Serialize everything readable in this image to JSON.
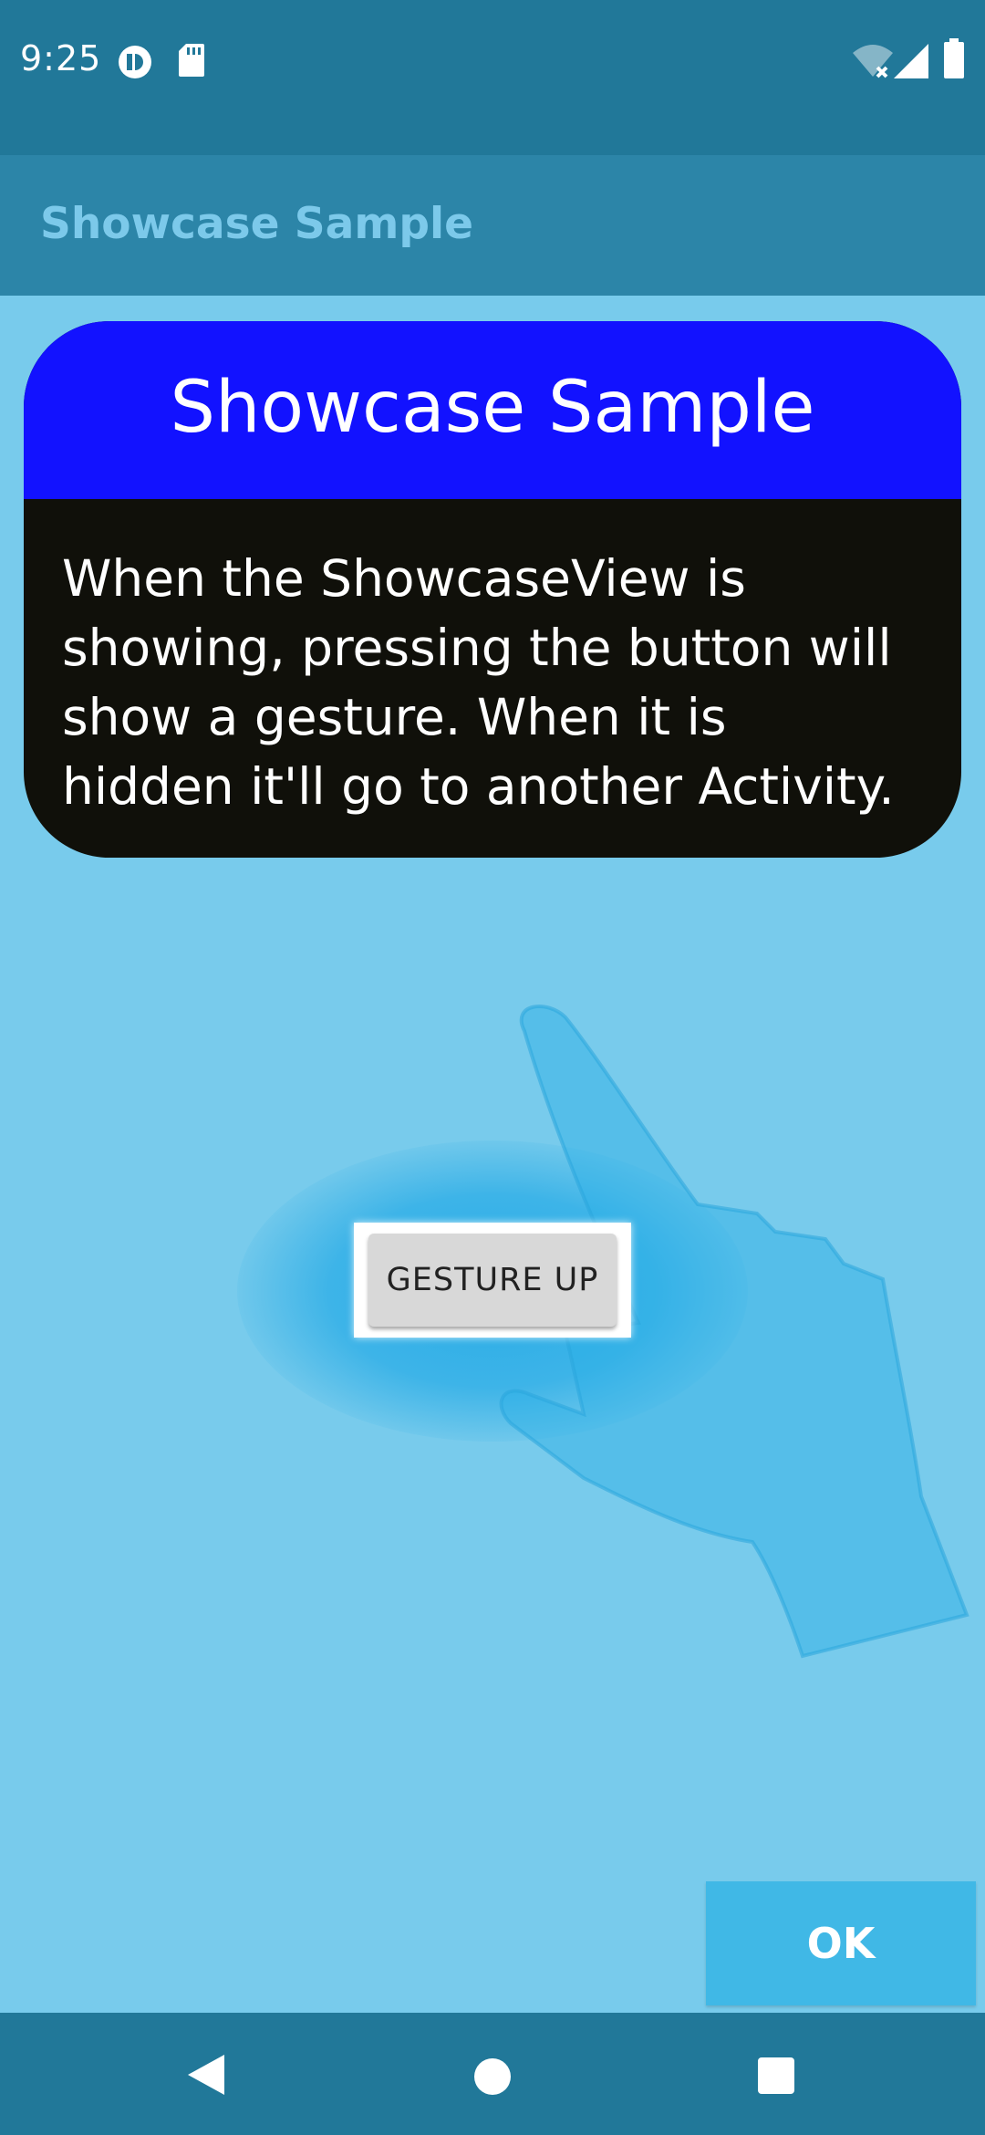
{
  "status_bar": {
    "time": "9:25",
    "icons": [
      "sync-icon",
      "sd-card-icon",
      "wifi-off-icon",
      "cell-signal-icon",
      "battery-icon"
    ]
  },
  "app_bar": {
    "title": "Showcase Sample"
  },
  "showcase": {
    "title": "Showcase Sample",
    "description": "When the ShowcaseView is\nshowing, pressing the button will\nshow a gesture. When it is\nhidden it'll go to another Activity."
  },
  "gesture_button": {
    "label": "GESTURE UP"
  },
  "ok_button": {
    "label": "OK"
  },
  "nav_bar": {
    "icons": [
      "back-icon",
      "home-icon",
      "recents-icon"
    ]
  },
  "colors": {
    "status_bar": "#217899",
    "app_bar": "#2c85a8",
    "overlay": "#78cbec",
    "card_header": "#1212ff",
    "card_body": "#10100a",
    "ok_button": "#40b8e6"
  }
}
